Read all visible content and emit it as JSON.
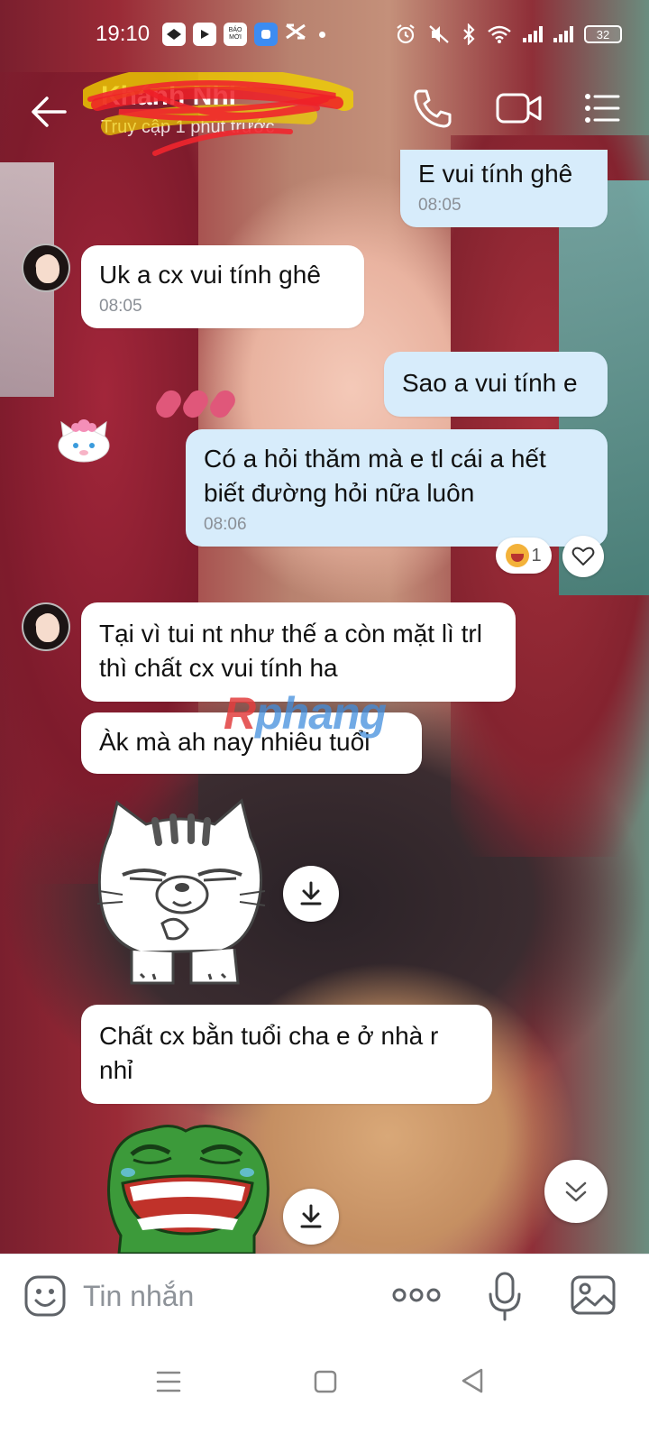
{
  "status_bar": {
    "time": "19:10",
    "app_icon_news": "BÁO MỚI",
    "battery": "32"
  },
  "header": {
    "contact_name": "Khánh Nhi",
    "contact_status": "Truy cập 1 phút trước"
  },
  "messages": [
    {
      "id": "m1",
      "direction": "out",
      "text": "E vui tính ghê",
      "time": "08:05"
    },
    {
      "id": "m2",
      "direction": "in",
      "text": "Uk a cx vui tính ghê",
      "time": "08:05"
    },
    {
      "id": "m3",
      "direction": "out",
      "text": "Sao a vui tính e"
    },
    {
      "id": "m4",
      "direction": "out",
      "text": "Có a hỏi thăm mà e tl cái a hết biết đường hỏi nữa luôn",
      "time": "08:06",
      "reaction_count": "1"
    },
    {
      "id": "m5",
      "direction": "in",
      "text": "Tại vì tui nt như thế a còn mặt lì trl thì chất cx vui tính ha"
    },
    {
      "id": "m6",
      "direction": "in",
      "text": "Àk mà ah nay nhiêu tuổi"
    },
    {
      "id": "m7",
      "direction": "in",
      "type": "sticker",
      "sticker": "grumpy-cat"
    },
    {
      "id": "m8",
      "direction": "in",
      "text": "Chất cx bằn tuổi cha e ở nhà r nhỉ"
    },
    {
      "id": "m9",
      "direction": "in",
      "type": "sticker",
      "sticker": "laughing-frog"
    }
  ],
  "watermark": {
    "first_letter": "R",
    "rest": "phang"
  },
  "composer": {
    "placeholder": "Tin nhắn"
  },
  "colors": {
    "outgoing_bubble": "#d7ecfb",
    "incoming_bubble": "#ffffff",
    "timestamp": "#8a8f96",
    "accent": "#0068ff"
  },
  "icons": {
    "back": "arrow-left-icon",
    "call": "phone-icon",
    "video": "video-camera-icon",
    "menu": "list-menu-icon",
    "emoji": "emoji-icon",
    "more": "more-dots-icon",
    "mic": "microphone-icon",
    "image": "image-icon",
    "download": "download-icon",
    "scroll_down": "double-chevron-down-icon",
    "heart": "heart-icon"
  }
}
